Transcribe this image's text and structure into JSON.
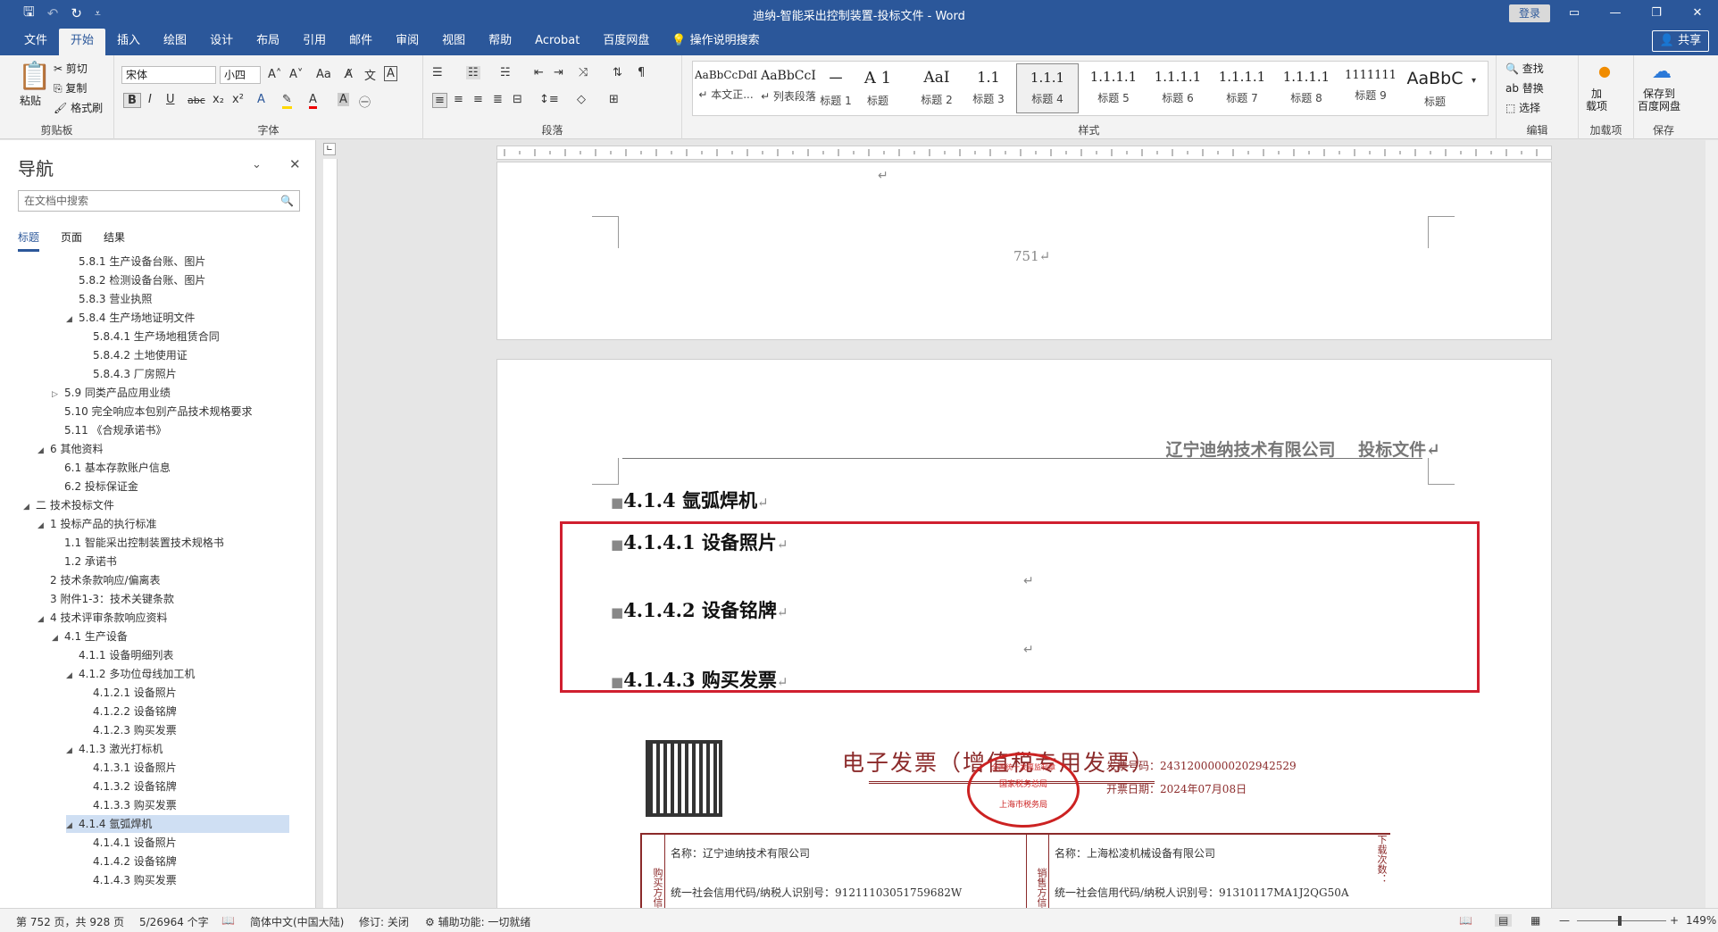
{
  "window": {
    "title": "迪纳-智能采出控制装置-投标文件  -  Word",
    "login_label": "登录",
    "share_label": "共享",
    "controls": [
      "▭",
      "—",
      "❐",
      "✕"
    ]
  },
  "quick_access": {
    "save": "🖫",
    "undo": "↶",
    "redo": "↻",
    "more": "⩡"
  },
  "tabs": [
    "文件",
    "开始",
    "插入",
    "绘图",
    "设计",
    "布局",
    "引用",
    "邮件",
    "审阅",
    "视图",
    "帮助",
    "Acrobat",
    "百度网盘"
  ],
  "active_tab": "开始",
  "tell_me": "操作说明搜索",
  "ribbon": {
    "clipboard": {
      "label": "剪贴板",
      "paste": "粘贴",
      "cut": "剪切",
      "copy": "复制",
      "format_painter": "格式刷"
    },
    "font": {
      "label": "字体",
      "font_name": "宋体",
      "font_size": "小四",
      "change_case": "Aa"
    },
    "paragraph": {
      "label": "段落"
    },
    "styles": {
      "label": "样式",
      "items": [
        {
          "preview": "AaBbCcDdI",
          "name": "↵ 本文正..."
        },
        {
          "preview": "AaBbCcI",
          "name": "↵ 列表段落"
        },
        {
          "preview": "一",
          "name": "标题 1"
        },
        {
          "preview": "A 1",
          "name": "标题"
        },
        {
          "preview": "AaI",
          "name": "标题 2"
        },
        {
          "preview": "1.1",
          "name": "标题 3"
        },
        {
          "preview": "1.1.1",
          "name": "标题 4"
        },
        {
          "preview": "1.1.1.1",
          "name": "标题 5"
        },
        {
          "preview": "1.1.1.1",
          "name": "标题 6"
        },
        {
          "preview": "1.1.1.1",
          "name": "标题 7"
        },
        {
          "preview": "1.1.1.1",
          "name": "标题 8"
        },
        {
          "preview": "1111111",
          "name": "标题 9"
        },
        {
          "preview": "AaBbC",
          "name": "标题"
        }
      ]
    },
    "editing": {
      "label": "编辑",
      "find": "查找",
      "replace": "替换",
      "select": "选择"
    },
    "addins": {
      "label": "加载项",
      "button": "加\n载项"
    },
    "save": {
      "label": "保存",
      "button": "保存到\n百度网盘"
    }
  },
  "nav": {
    "title": "导航",
    "search_placeholder": "在文档中搜索",
    "tabs": [
      "标题",
      "页面",
      "结果"
    ],
    "items": [
      {
        "text": "5.8.1 生产设备台账、图片",
        "level": 3,
        "tri": ""
      },
      {
        "text": "5.8.2 检测设备台账、图片",
        "level": 3,
        "tri": ""
      },
      {
        "text": "5.8.3 营业执照",
        "level": 3,
        "tri": ""
      },
      {
        "text": "5.8.4 生产场地证明文件",
        "level": 3,
        "tri": "◢"
      },
      {
        "text": "5.8.4.1 生产场地租赁合同",
        "level": 4,
        "tri": ""
      },
      {
        "text": "5.8.4.2 土地使用证",
        "level": 4,
        "tri": ""
      },
      {
        "text": "5.8.4.3 厂房照片",
        "level": 4,
        "tri": ""
      },
      {
        "text": "5.9 同类产品应用业绩",
        "level": 2,
        "tri": "▷"
      },
      {
        "text": "5.10 完全响应本包别产品技术规格要求",
        "level": 2,
        "tri": ""
      },
      {
        "text": "5.11 《合规承诺书》",
        "level": 2,
        "tri": ""
      },
      {
        "text": "6 其他资料",
        "level": 1,
        "tri": "◢"
      },
      {
        "text": "6.1 基本存款账户信息",
        "level": 2,
        "tri": ""
      },
      {
        "text": "6.2 投标保证金",
        "level": 2,
        "tri": ""
      },
      {
        "text": "二 技术投标文件",
        "level": 0,
        "tri": "◢"
      },
      {
        "text": "1 投标产品的执行标准",
        "level": 1,
        "tri": "◢"
      },
      {
        "text": "1.1 智能采出控制装置技术规格书",
        "level": 2,
        "tri": ""
      },
      {
        "text": "1.2 承诺书",
        "level": 2,
        "tri": ""
      },
      {
        "text": "2 技术条款响应/偏离表",
        "level": 1,
        "tri": ""
      },
      {
        "text": "3 附件1-3：技术关键条款",
        "level": 1,
        "tri": ""
      },
      {
        "text": "4 技术评审条款响应资料",
        "level": 1,
        "tri": "◢"
      },
      {
        "text": "4.1 生产设备",
        "level": 2,
        "tri": "◢"
      },
      {
        "text": "4.1.1 设备明细列表",
        "level": 3,
        "tri": ""
      },
      {
        "text": "4.1.2 多功位母线加工机",
        "level": 3,
        "tri": "◢"
      },
      {
        "text": "4.1.2.1 设备照片",
        "level": 4,
        "tri": ""
      },
      {
        "text": "4.1.2.2 设备铭牌",
        "level": 4,
        "tri": ""
      },
      {
        "text": "4.1.2.3 购买发票",
        "level": 4,
        "tri": ""
      },
      {
        "text": "4.1.3 激光打标机",
        "level": 3,
        "tri": "◢"
      },
      {
        "text": "4.1.3.1 设备照片",
        "level": 4,
        "tri": ""
      },
      {
        "text": "4.1.3.2 设备铭牌",
        "level": 4,
        "tri": ""
      },
      {
        "text": "4.1.3.3 购买发票",
        "level": 4,
        "tri": ""
      },
      {
        "text": "4.1.4 氩弧焊机",
        "level": 3,
        "tri": "◢",
        "current": true
      },
      {
        "text": "4.1.4.1 设备照片",
        "level": 4,
        "tri": ""
      },
      {
        "text": "4.1.4.2 设备铭牌",
        "level": 4,
        "tri": ""
      },
      {
        "text": "4.1.4.3 购买发票",
        "level": 4,
        "tri": ""
      }
    ]
  },
  "document": {
    "page_number": "751↵",
    "top_mark": "↵",
    "header_text": "辽宁迪纳技术有限公司　 投标文件↵",
    "heading_main": "4.1.4 氩弧焊机",
    "sub1": "4.1.4.1 设备照片",
    "sub2": "4.1.4.2 设备铭牌",
    "sub3": "4.1.4.3 购买发票",
    "para_mark": "↵",
    "invoice": {
      "title": "电子发票（增值税专用发票）",
      "number_label": "发票号码：24312000000202942529",
      "date_label": "开票日期：2024年07月08日",
      "seal_top": "全国统一发票监制章",
      "seal_mid": "国家税务总局",
      "seal_bottom": "上海市税务局",
      "buyer_side": "购买方信息",
      "seller_side": "销售方信息",
      "buyer_name": "名称：辽宁迪纳技术有限公司",
      "seller_name": "名称：上海松凌机械设备有限公司",
      "buyer_id": "统一社会信用代码/纳税人识别号：91211103051759682W",
      "seller_id": "统一社会信用代码/纳税人识别号：91310117MA1J2QG50A",
      "download_label": "下载次数："
    }
  },
  "status": {
    "page": "第 752 页，共 928 页",
    "words": "5/26964 个字",
    "language": "简体中文(中国大陆)",
    "track": "修订: 关闭",
    "accessibility": "辅助功能: 一切就绪",
    "zoom": "149%"
  },
  "colors": {
    "brand": "#2b579a",
    "highlight_box": "#d01f2f",
    "nav_selected": "#cfdff3"
  }
}
